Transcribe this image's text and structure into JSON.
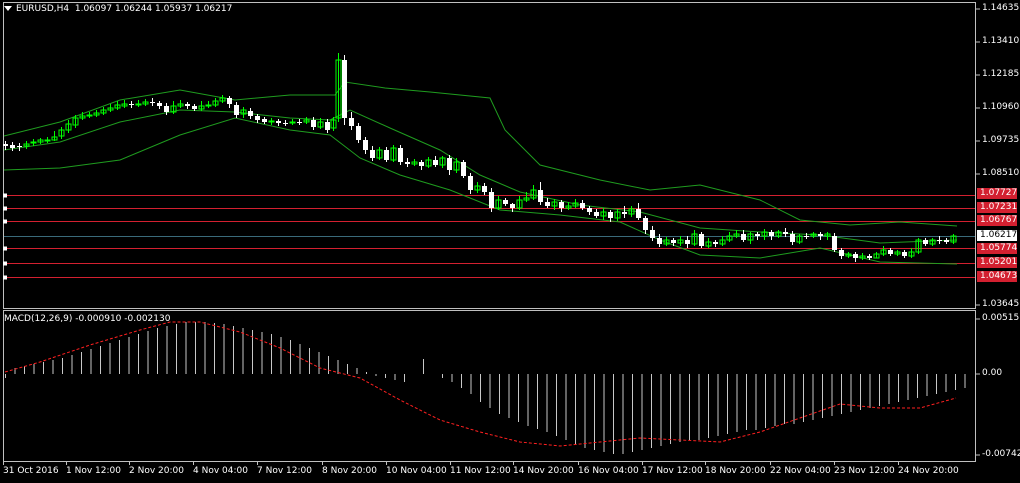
{
  "window": {
    "symbol_label": "EURUSD,H4",
    "ohlc": "1.06097 1.06244 1.05937 1.06217",
    "indicator_label": "MACD(12,26,9) -0.000910 -0.002130"
  },
  "price_axis": {
    "ticks": [
      "1.14635",
      "1.13410",
      "1.12185",
      "1.10960",
      "1.09735",
      "1.08510",
      "1.03645"
    ],
    "current": "1.06217"
  },
  "macd_axis": {
    "ticks": [
      "0.005157",
      "0.00",
      "-0.007423"
    ]
  },
  "levels": [
    {
      "value": "1.07727",
      "price": 1.07727
    },
    {
      "value": "1.07231",
      "price": 1.07231
    },
    {
      "value": "1.06767",
      "price": 1.06767
    },
    {
      "value": "1.05774",
      "price": 1.05774
    },
    {
      "value": "1.05201",
      "price": 1.05201
    },
    {
      "value": "1.04673",
      "price": 1.04673
    }
  ],
  "time_axis": [
    "31 Oct 2016",
    "1 Nov 12:00",
    "2 Nov 20:00",
    "4 Nov 04:00",
    "7 Nov 12:00",
    "8 Nov 20:00",
    "10 Nov 04:00",
    "11 Nov 12:00",
    "14 Nov 20:00",
    "16 Nov 04:00",
    "17 Nov 12:00",
    "18 Nov 20:00",
    "22 Nov 04:00",
    "23 Nov 12:00",
    "24 Nov 20:00"
  ],
  "colors": {
    "background": "#000000",
    "grid": "#c0c0c0",
    "bullish": "#00ff00",
    "bearish": "#ffffff",
    "bands": "#1f9c1f",
    "level_line": "#d32030",
    "macd_histogram": "#c8c8c8",
    "macd_signal": "#ff2020"
  }
}
